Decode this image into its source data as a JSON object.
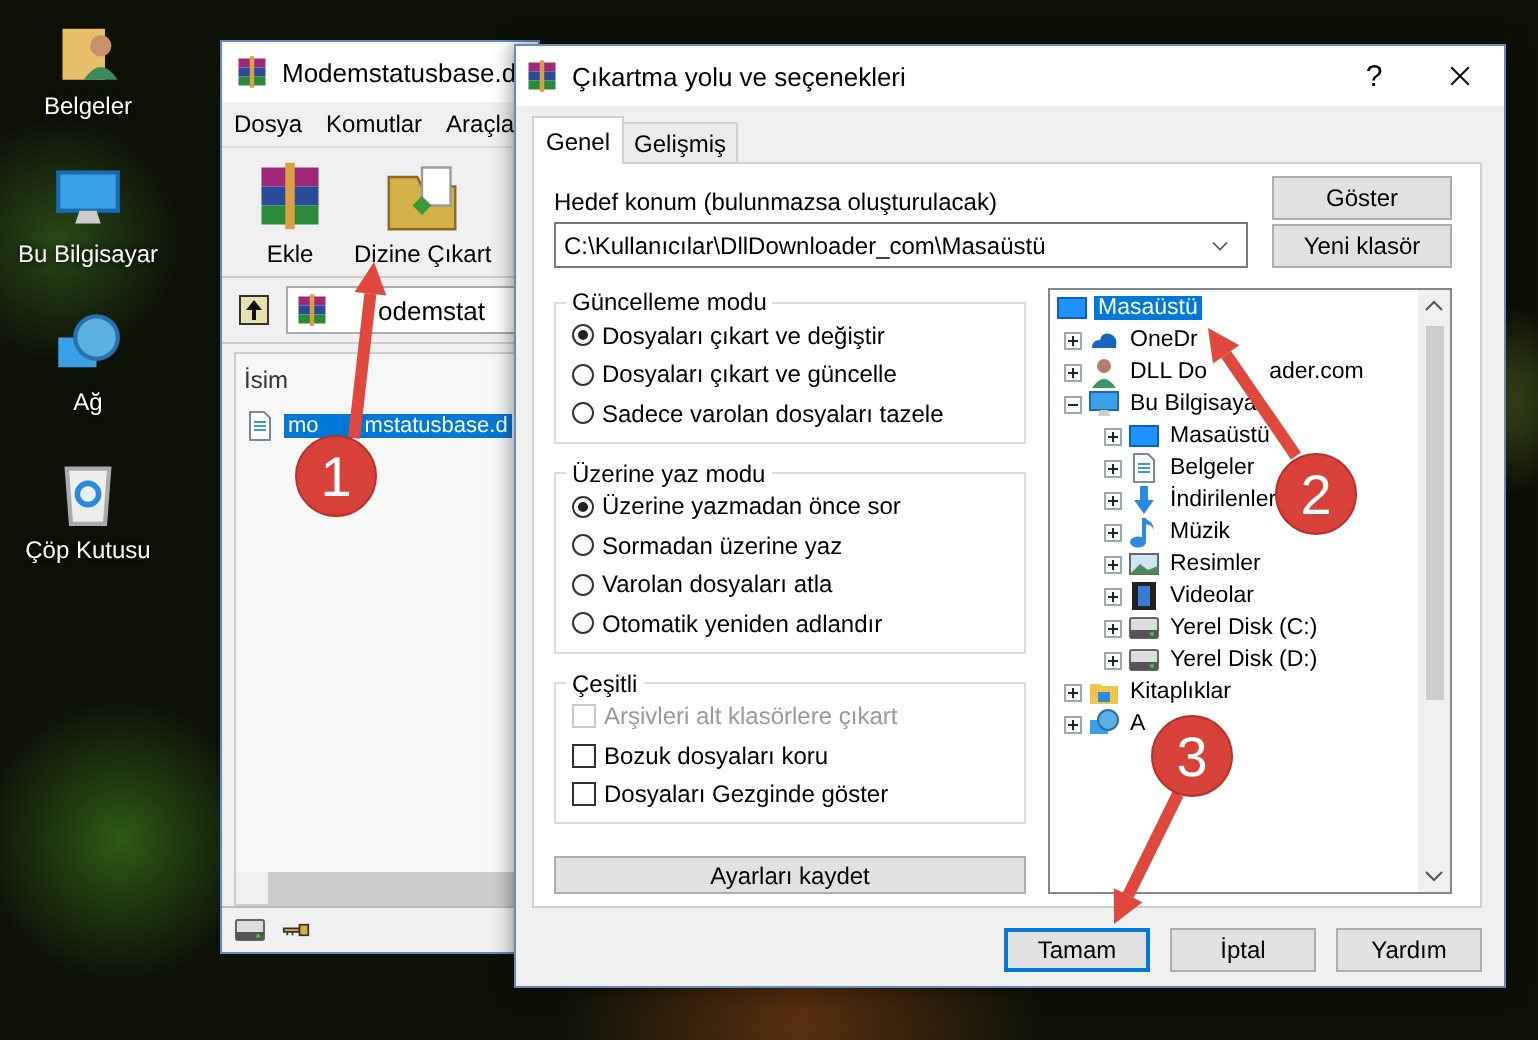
{
  "desktop": {
    "icons": [
      {
        "label": "Belgeler",
        "kind": "user-folder"
      },
      {
        "label": "Bu Bilgisayar",
        "kind": "computer"
      },
      {
        "label": "Ağ",
        "kind": "network"
      },
      {
        "label": "Çöp Kutusu",
        "kind": "recycle"
      }
    ]
  },
  "archiver": {
    "title": "Modemstatusbase.d",
    "menu": [
      "Dosya",
      "Komutlar",
      "Araçla"
    ],
    "toolbar": [
      {
        "label": "Ekle",
        "kind": "add"
      },
      {
        "label": "Dizine Çıkart",
        "kind": "extract"
      }
    ],
    "address": "odemstat",
    "columns": [
      "İsim"
    ],
    "files": [
      {
        "name": "mo",
        "name_after_badge": "mstatusbase.d",
        "selected": true
      }
    ]
  },
  "dialog": {
    "title": "Çıkartma yolu ve seçenekleri",
    "help": "?",
    "tabs": [
      {
        "label": "Genel",
        "selected": true
      },
      {
        "label": "Gelişmiş",
        "selected": false
      }
    ],
    "destination": {
      "label": "Hedef konum (bulunmazsa oluşturulacak)",
      "value": "C:\\Kullanıcılar\\DllDownloader_com\\Masaüstü"
    },
    "side_buttons": [
      "Göster",
      "Yeni klasör"
    ],
    "groups": [
      {
        "title": "Güncelleme modu",
        "options": [
          {
            "kind": "radio",
            "label": "Dosyaları çıkart ve değiştir",
            "selected": true
          },
          {
            "kind": "radio",
            "label": "Dosyaları çıkart ve güncelle",
            "selected": false
          },
          {
            "kind": "radio",
            "label": "Sadece varolan dosyaları tazele",
            "selected": false
          }
        ]
      },
      {
        "title": "Üzerine yaz modu",
        "options": [
          {
            "kind": "radio",
            "label": "Üzerine yazmadan önce sor",
            "selected": true
          },
          {
            "kind": "radio",
            "label": "Sormadan üzerine yaz",
            "selected": false
          },
          {
            "kind": "radio",
            "label": "Varolan dosyaları atla",
            "selected": false
          },
          {
            "kind": "radio",
            "label": "Otomatik yeniden adlandır",
            "selected": false
          }
        ]
      },
      {
        "title": "Çeşitli",
        "options": [
          {
            "kind": "checkbox",
            "label": "Arşivleri alt klasörlere çıkart",
            "checked": false,
            "disabled": true
          },
          {
            "kind": "checkbox",
            "label": "Bozuk dosyaları koru",
            "checked": false,
            "disabled": false
          },
          {
            "kind": "checkbox",
            "label": "Dosyaları Gezginde göster",
            "checked": false,
            "disabled": false
          }
        ]
      }
    ],
    "save_button": "Ayarları kaydet",
    "tree": [
      {
        "label": "Masaüstü",
        "kind": "desktop",
        "selected": true,
        "children": [
          {
            "label": "OneDr",
            "kind": "cloud",
            "selected": false,
            "expanded": false
          },
          {
            "label": "DLL Do",
            "label_after_arrow": "ader.com",
            "kind": "user",
            "selected": false,
            "expanded": false
          },
          {
            "label": "Bu Bilgisaya",
            "kind": "computer",
            "selected": false,
            "expanded": true,
            "children": [
              {
                "label": "Masaüstü",
                "kind": "desktop",
                "selected": false,
                "expanded": false
              },
              {
                "label": "Belgeler",
                "kind": "documents",
                "selected": false,
                "expanded": false
              },
              {
                "label": "İndirilenler",
                "kind": "downloads",
                "selected": false,
                "expanded": false
              },
              {
                "label": "Müzik",
                "kind": "music",
                "selected": false,
                "expanded": false
              },
              {
                "label": "Resimler",
                "kind": "pictures",
                "selected": false,
                "expanded": false
              },
              {
                "label": "Videolar",
                "kind": "videos",
                "selected": false,
                "expanded": false
              },
              {
                "label": "Yerel Disk (C:)",
                "kind": "drive",
                "selected": false,
                "expanded": false
              },
              {
                "label": "Yerel Disk (D:)",
                "kind": "drive",
                "selected": false,
                "expanded": false
              }
            ]
          },
          {
            "label": "Kitaplıklar",
            "kind": "library",
            "selected": false,
            "expanded": false
          },
          {
            "label": "A",
            "kind": "network",
            "selected": false,
            "expanded": false
          }
        ]
      }
    ],
    "buttons": [
      {
        "label": "Tamam",
        "default": true
      },
      {
        "label": "İptal",
        "default": false
      },
      {
        "label": "Yardım",
        "default": false
      }
    ]
  },
  "callouts": [
    {
      "number": "1"
    },
    {
      "number": "2"
    },
    {
      "number": "3"
    }
  ]
}
